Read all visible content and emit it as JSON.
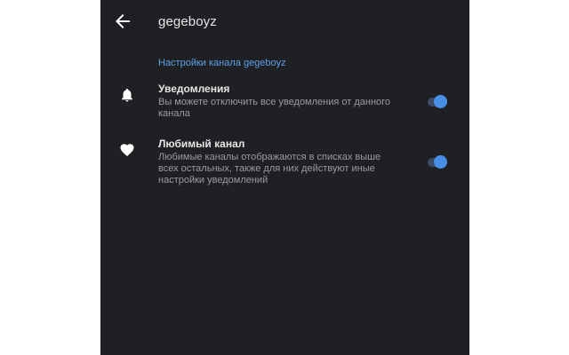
{
  "header": {
    "back_icon": "arrow-left-icon",
    "title": "gegeboyz"
  },
  "section": {
    "title": "Настройки канала gegeboyz"
  },
  "settings": [
    {
      "icon": "bell-icon",
      "title": "Уведомления",
      "description": "Вы можете отключить все уведомления от данного канала",
      "enabled": true
    },
    {
      "icon": "heart-icon",
      "title": "Любимый канал",
      "description": "Любимые каналы отображаются в списках выше всех остальных, также для них действуют иные настройки уведомлений",
      "enabled": true
    }
  ],
  "colors": {
    "background": "#1f2023",
    "accent": "#4a8fe7",
    "section_title": "#5ea0e8",
    "text_primary": "#e6e6e6",
    "text_secondary": "#9a9ba0"
  }
}
